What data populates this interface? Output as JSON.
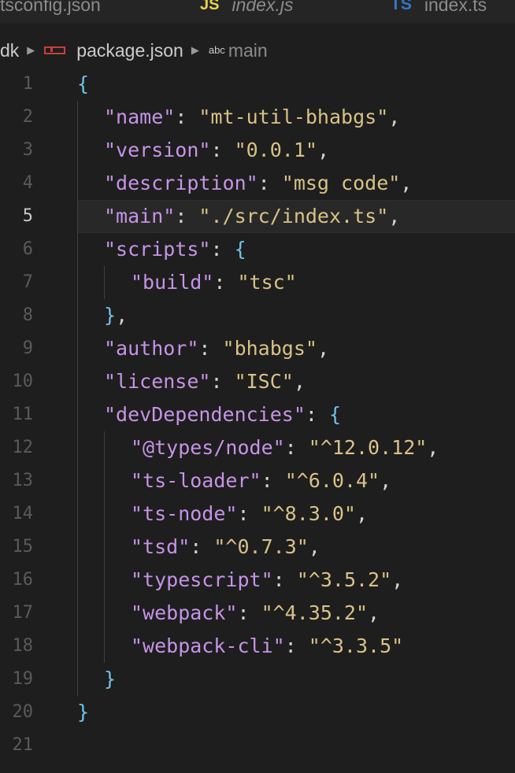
{
  "tabs": [
    {
      "label": "tsconfig.json",
      "icon": "braces-icon",
      "style": "normal"
    },
    {
      "label": "index.js",
      "icon": "js-icon",
      "icon_text": "JS",
      "style": "italic"
    },
    {
      "label": "index.ts",
      "icon": "ts-icon",
      "icon_text": "TS",
      "style": "normal"
    }
  ],
  "breadcrumb": {
    "folder": "dk",
    "file": "package.json",
    "symbol_badge": "abc",
    "symbol": "main"
  },
  "editor": {
    "current_line": 5,
    "lines": [
      {
        "num": "1",
        "indent": 0,
        "tokens": [
          {
            "t": "b",
            "v": "{"
          }
        ]
      },
      {
        "num": "2",
        "indent": 1,
        "tokens": [
          {
            "t": "k",
            "v": "\"name\""
          },
          {
            "t": "p",
            "v": ": "
          },
          {
            "t": "s",
            "v": "\"mt-util-bhabgs\""
          },
          {
            "t": "p",
            "v": ","
          }
        ]
      },
      {
        "num": "3",
        "indent": 1,
        "tokens": [
          {
            "t": "k",
            "v": "\"version\""
          },
          {
            "t": "p",
            "v": ": "
          },
          {
            "t": "s",
            "v": "\"0.0.1\""
          },
          {
            "t": "p",
            "v": ","
          }
        ]
      },
      {
        "num": "4",
        "indent": 1,
        "tokens": [
          {
            "t": "k",
            "v": "\"description\""
          },
          {
            "t": "p",
            "v": ": "
          },
          {
            "t": "s",
            "v": "\"msg code\""
          },
          {
            "t": "p",
            "v": ","
          }
        ]
      },
      {
        "num": "5",
        "indent": 1,
        "tokens": [
          {
            "t": "k",
            "v": "\"main\""
          },
          {
            "t": "p",
            "v": ": "
          },
          {
            "t": "s",
            "v": "\"./src/index.ts\""
          },
          {
            "t": "p",
            "v": ","
          }
        ]
      },
      {
        "num": "6",
        "indent": 1,
        "tokens": [
          {
            "t": "k",
            "v": "\"scripts\""
          },
          {
            "t": "p",
            "v": ": "
          },
          {
            "t": "b",
            "v": "{"
          }
        ]
      },
      {
        "num": "7",
        "indent": 2,
        "tokens": [
          {
            "t": "k",
            "v": "\"build\""
          },
          {
            "t": "p",
            "v": ": "
          },
          {
            "t": "s",
            "v": "\"tsc\""
          }
        ]
      },
      {
        "num": "8",
        "indent": 1,
        "tokens": [
          {
            "t": "b",
            "v": "}"
          },
          {
            "t": "p",
            "v": ","
          }
        ]
      },
      {
        "num": "9",
        "indent": 1,
        "tokens": [
          {
            "t": "k",
            "v": "\"author\""
          },
          {
            "t": "p",
            "v": ": "
          },
          {
            "t": "s",
            "v": "\"bhabgs\""
          },
          {
            "t": "p",
            "v": ","
          }
        ]
      },
      {
        "num": "10",
        "indent": 1,
        "tokens": [
          {
            "t": "k",
            "v": "\"license\""
          },
          {
            "t": "p",
            "v": ": "
          },
          {
            "t": "s",
            "v": "\"ISC\""
          },
          {
            "t": "p",
            "v": ","
          }
        ]
      },
      {
        "num": "11",
        "indent": 1,
        "tokens": [
          {
            "t": "k",
            "v": "\"devDependencies\""
          },
          {
            "t": "p",
            "v": ": "
          },
          {
            "t": "b",
            "v": "{"
          }
        ]
      },
      {
        "num": "12",
        "indent": 2,
        "tokens": [
          {
            "t": "k",
            "v": "\"@types/node\""
          },
          {
            "t": "p",
            "v": ": "
          },
          {
            "t": "s",
            "v": "\"^12.0.12\""
          },
          {
            "t": "p",
            "v": ","
          }
        ]
      },
      {
        "num": "13",
        "indent": 2,
        "tokens": [
          {
            "t": "k",
            "v": "\"ts-loader\""
          },
          {
            "t": "p",
            "v": ": "
          },
          {
            "t": "s",
            "v": "\"^6.0.4\""
          },
          {
            "t": "p",
            "v": ","
          }
        ]
      },
      {
        "num": "14",
        "indent": 2,
        "tokens": [
          {
            "t": "k",
            "v": "\"ts-node\""
          },
          {
            "t": "p",
            "v": ": "
          },
          {
            "t": "s",
            "v": "\"^8.3.0\""
          },
          {
            "t": "p",
            "v": ","
          }
        ]
      },
      {
        "num": "15",
        "indent": 2,
        "tokens": [
          {
            "t": "k",
            "v": "\"tsd\""
          },
          {
            "t": "p",
            "v": ": "
          },
          {
            "t": "s",
            "v": "\"^0.7.3\""
          },
          {
            "t": "p",
            "v": ","
          }
        ]
      },
      {
        "num": "16",
        "indent": 2,
        "tokens": [
          {
            "t": "k",
            "v": "\"typescript\""
          },
          {
            "t": "p",
            "v": ": "
          },
          {
            "t": "s",
            "v": "\"^3.5.2\""
          },
          {
            "t": "p",
            "v": ","
          }
        ]
      },
      {
        "num": "17",
        "indent": 2,
        "tokens": [
          {
            "t": "k",
            "v": "\"webpack\""
          },
          {
            "t": "p",
            "v": ": "
          },
          {
            "t": "s",
            "v": "\"^4.35.2\""
          },
          {
            "t": "p",
            "v": ","
          }
        ]
      },
      {
        "num": "18",
        "indent": 2,
        "tokens": [
          {
            "t": "k",
            "v": "\"webpack-cli\""
          },
          {
            "t": "p",
            "v": ": "
          },
          {
            "t": "s",
            "v": "\"^3.3.5\""
          }
        ]
      },
      {
        "num": "19",
        "indent": 1,
        "tokens": [
          {
            "t": "b",
            "v": "}"
          }
        ]
      },
      {
        "num": "20",
        "indent": 0,
        "tokens": [
          {
            "t": "b",
            "v": "}"
          }
        ]
      },
      {
        "num": "21",
        "indent": 0,
        "tokens": []
      }
    ]
  }
}
